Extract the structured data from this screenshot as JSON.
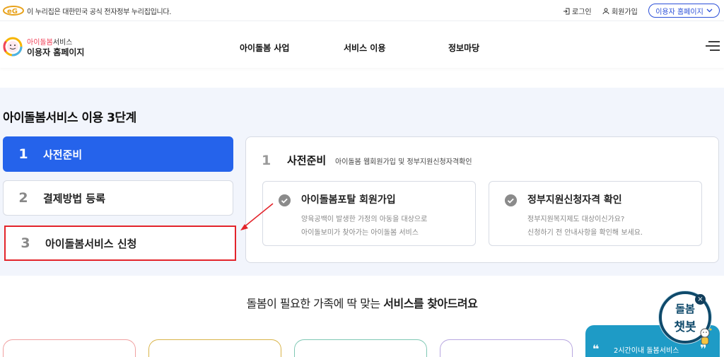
{
  "gov_bar": {
    "notice": "이 누리집은 대한민국 공식 전자정부 누리집입니다.",
    "login": "로그인",
    "join": "회원가입",
    "user_home": "이용자 홈페이지"
  },
  "header": {
    "brand_accent": "아이돌봄",
    "brand_suffix": "서비스",
    "brand_main": "이용자 홈페이지",
    "nav": [
      "아이돌봄 사업",
      "서비스 이용",
      "정보마당"
    ]
  },
  "steps": {
    "title": "아이돌봄서비스 이용 3단계",
    "items": [
      {
        "num": "1",
        "label": "사전준비"
      },
      {
        "num": "2",
        "label": "결제방법 등록"
      },
      {
        "num": "3",
        "label": "아이돌봄서비스 신청"
      }
    ],
    "detail": {
      "num": "1",
      "title": "사전준비",
      "desc": "아이돌봄 웹회원가입 및 정부지원신청자격확인",
      "cards": [
        {
          "title": "아이돌봄포탈 회원가입",
          "line1": "양육공백이 발생한 가정의 아동을 대상으로",
          "line2": "아이돌보미가 찾아가는 아이돌봄 서비스"
        },
        {
          "title": "정부지원신청자격 확인",
          "line1": "정부지원복지제도 대상이신가요?",
          "line2": "신청하기 전 안내사항을 확인해 보세요."
        }
      ]
    }
  },
  "services": {
    "title_normal": "돌봄이 필요한 가족에 딱 맞는 ",
    "title_bold": "서비스를 찾아드려요",
    "blue_card_text": "2시간이내 돌봄서비스"
  },
  "chatbot": {
    "line1": "돌봄",
    "line2": "챗봇",
    "close": "×"
  },
  "colors": {
    "primary": "#2563eb",
    "highlight": "#e3242b",
    "chatbot": "#0f4a6b",
    "service_blue": "#1e9bc6"
  }
}
